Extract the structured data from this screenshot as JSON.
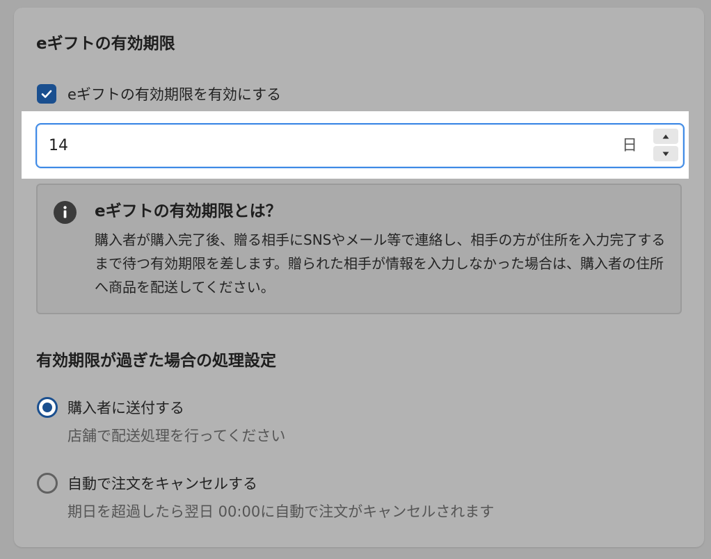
{
  "section_expiry": {
    "title": "eギフトの有効期限",
    "checkbox": {
      "label": "eギフトの有効期限を有効にする",
      "checked": true
    },
    "input": {
      "value": "14",
      "unit": "日"
    },
    "info": {
      "icon": "info-icon",
      "title": "eギフトの有効期限とは？",
      "body": "購入者が購入完了後、贈る相手にSNSやメール等で連絡し、相手の方が住所を入力完了するまで待つ有効期限を差します。贈られた相手が情報を入力しなかった場合は、購入者の住所へ商品を配送してください。"
    }
  },
  "section_after": {
    "title": "有効期限が過ぎた場合の処理設定",
    "options": [
      {
        "label": "購入者に送付する",
        "help": "店舗で配送処理を行ってください",
        "selected": true
      },
      {
        "label": "自動で注文をキャンセルする",
        "help": "期日を超過したら翌日 00:00に自動で注文がキャンセルされます",
        "selected": false
      }
    ]
  },
  "colors": {
    "accent": "#1a4f8f",
    "focus_border": "#3f8ae6",
    "overlay_background": "#a8a8a8"
  }
}
